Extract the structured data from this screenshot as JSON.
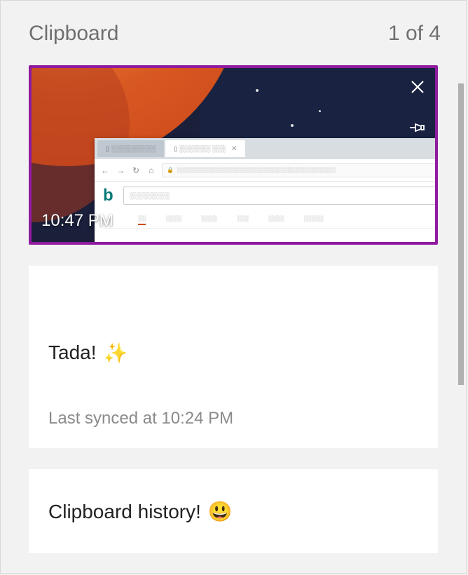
{
  "header": {
    "title": "Clipboard",
    "counter": "1 of 4"
  },
  "items": [
    {
      "type": "image",
      "timestamp": "10:47 PM",
      "icons": {
        "delete": "close-icon",
        "pin": "pin-icon"
      }
    },
    {
      "type": "text",
      "content": "Tada!",
      "emoji": "✨",
      "meta": "Last synced at 10:24 PM"
    },
    {
      "type": "text",
      "content": "Clipboard history!",
      "emoji": "😃"
    }
  ]
}
